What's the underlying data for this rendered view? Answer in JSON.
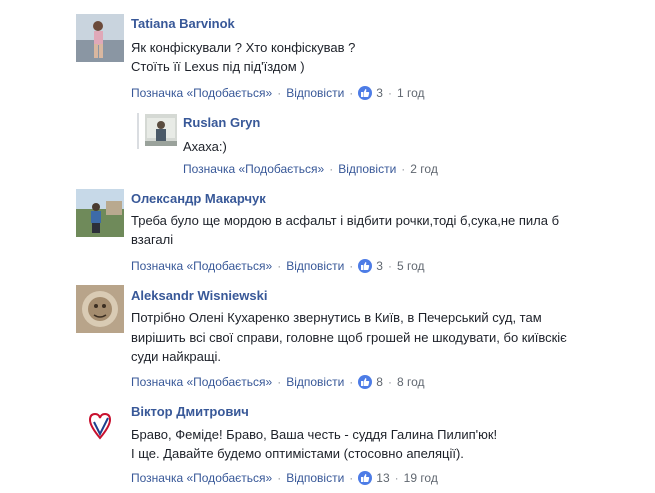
{
  "comments": [
    {
      "author": "Tatiana Barvinok",
      "lines": [
        "Як конфіскували ? Хто конфіскував ?",
        "Стоїть її Lexus під під'їздом )"
      ],
      "like_label": "Позначка «Подобається»",
      "reply_label": "Відповісти",
      "likes": "3",
      "time": "1 год"
    },
    {
      "author": "Ruslan Gryn",
      "lines": [
        "Ахаха:)"
      ],
      "like_label": "Позначка «Подобається»",
      "reply_label": "Відповісти",
      "time": "2 год"
    },
    {
      "author": "Олександр Макарчук",
      "lines": [
        "Треба було ще мордою в асфальт і відбити рочки,тоді б,сука,не пила б",
        "взагалі"
      ],
      "like_label": "Позначка «Подобається»",
      "reply_label": "Відповісти",
      "likes": "3",
      "time": "5 год"
    },
    {
      "author": "Aleksandr Wisniewski",
      "lines": [
        "Потрібно Олені Кухаренко звернутись в Київ, в Печерський суд, там",
        "вирішить всі свої справи, головне щоб грошей не шкодувати, бо київскіє",
        "суди найкращі."
      ],
      "like_label": "Позначка «Подобається»",
      "reply_label": "Відповісти",
      "likes": "8",
      "time": "8 год"
    },
    {
      "author": "Віктор Дмитрович",
      "lines": [
        "Браво, Феміде! Браво, Ваша честь - суддя Галина Пилип'юк!",
        "І ще. Давайте будемо оптимістами (стосовно апеляції)."
      ],
      "like_label": "Позначка «Подобається»",
      "reply_label": "Відповісти",
      "likes": "13",
      "time": "19 год"
    }
  ],
  "colors": {
    "link": "#385898",
    "text": "#1d2129",
    "meta": "#606770",
    "like_badge": "#4d7ce6"
  },
  "icons": {
    "like": "thumbs-up-icon"
  }
}
